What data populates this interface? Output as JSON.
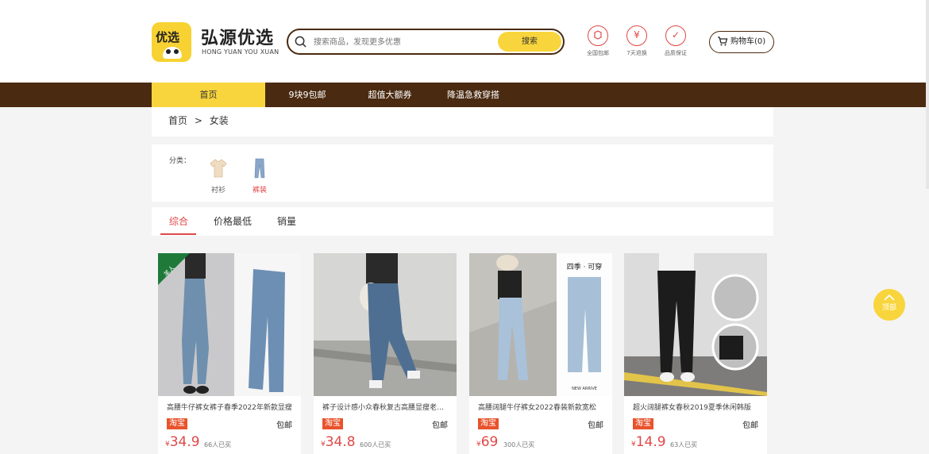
{
  "brand": {
    "logo_text": "优选",
    "name_cn": "弘源优选",
    "name_en": "HONG YUAN YOU XUAN"
  },
  "search": {
    "placeholder": "搜索商品，发现更多优惠",
    "button": "搜索"
  },
  "services": [
    {
      "icon": "package-icon",
      "label": "全国包邮"
    },
    {
      "icon": "yuan-icon",
      "label": "7天退换"
    },
    {
      "icon": "check-icon",
      "label": "品质保证"
    }
  ],
  "cart": {
    "label": "购物车(0)"
  },
  "nav": [
    "首页",
    "9块9包邮",
    "超值大额券",
    "降温急救穿搭"
  ],
  "breadcrumb": {
    "home": "首页",
    "sep": ">",
    "current": "女装"
  },
  "categories": {
    "label": "分类：",
    "items": [
      "衬衫",
      "裤装"
    ]
  },
  "sort": [
    "综合",
    "价格最低",
    "销量"
  ],
  "products": [
    {
      "title": "高腰牛仔裤女裤子春季2022年新款显瘦",
      "badge": "淘宝",
      "shipping": "包邮",
      "currency": "¥",
      "price": "34.9",
      "sold": "66人已买"
    },
    {
      "title": "裤子设计感小众春秋复古高腰显瘦老爹裤",
      "badge": "淘宝",
      "shipping": "包邮",
      "currency": "¥",
      "price": "34.8",
      "sold": "600人已买"
    },
    {
      "title": "高腰阔腿牛仔裤女2022春装新款宽松",
      "badge": "淘宝",
      "shipping": "包邮",
      "currency": "¥",
      "price": "69",
      "sold": "300人已买"
    },
    {
      "title": "超火阔腿裤女春秋2019夏季休闲韩版",
      "badge": "淘宝",
      "shipping": "包邮",
      "currency": "¥",
      "price": "14.9",
      "sold": "63人已买"
    }
  ],
  "product_image_text": {
    "p1_corner": "羊人",
    "p3_banner": "四季 · 可穿",
    "p3_sub": "NEW ARRIVE"
  },
  "back_to_top": "顶部"
}
